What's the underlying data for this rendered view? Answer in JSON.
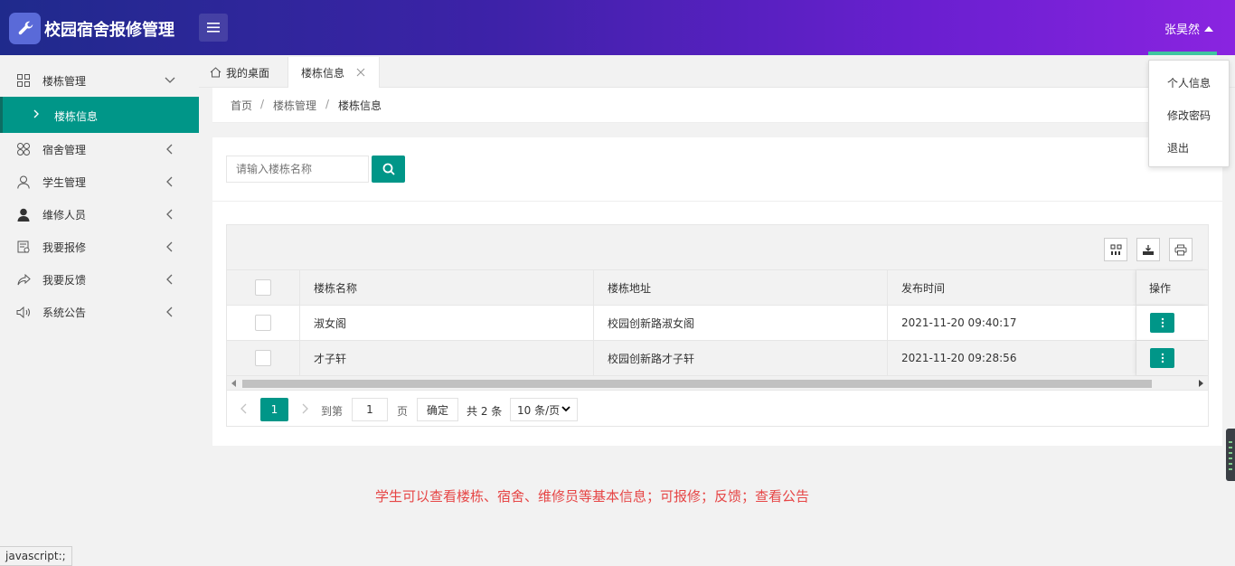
{
  "app": {
    "title": "校园宿舍报修管理"
  },
  "header": {
    "user_name": "张昊然"
  },
  "user_menu": {
    "items": [
      "个人信息",
      "修改密码",
      "退出"
    ]
  },
  "sidebar": {
    "items": [
      {
        "label": "楼栋管理",
        "icon": "grid-icon",
        "expanded": true
      },
      {
        "label": "宿舍管理",
        "icon": "clover-icon"
      },
      {
        "label": "学生管理",
        "icon": "user-outline-icon"
      },
      {
        "label": "维修人员",
        "icon": "user-filled-icon"
      },
      {
        "label": "我要报修",
        "icon": "calendar-icon"
      },
      {
        "label": "我要反馈",
        "icon": "share-icon"
      },
      {
        "label": "系统公告",
        "icon": "speaker-icon"
      }
    ],
    "sub_active": "楼栋信息"
  },
  "tabs": {
    "home": "我的桌面",
    "active": "楼栋信息"
  },
  "breadcrumb": [
    "首页",
    "楼栋管理",
    "楼栋信息"
  ],
  "search": {
    "placeholder": "请输入楼栋名称"
  },
  "table": {
    "headers": [
      "楼栋名称",
      "楼栋地址",
      "发布时间",
      "操作"
    ],
    "rows": [
      {
        "name": "淑女阁",
        "address": "校园创新路淑女阁",
        "time": "2021-11-20 09:40:17"
      },
      {
        "name": "才子轩",
        "address": "校园创新路才子轩",
        "time": "2021-11-20 09:28:56"
      }
    ]
  },
  "pagination": {
    "current": "1",
    "goto_label": "到第",
    "page_value": "1",
    "page_unit": "页",
    "confirm": "确定",
    "total": "共 2 条",
    "page_size": "10 条/页"
  },
  "note": "学生可以查看楼栋、宿舍、维修员等基本信息；可报修；反馈；查看公告",
  "status_bar": "javascript:;",
  "colors": {
    "primary": "#009688",
    "header_start": "#1f2a8c",
    "header_end": "#8a24e0",
    "note": "#e64545"
  }
}
